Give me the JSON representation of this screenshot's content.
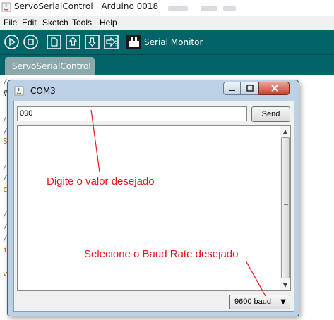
{
  "window": {
    "title": "ServoSerialControl | Arduino 0018"
  },
  "menu": {
    "items": [
      "File",
      "Edit",
      "Sketch",
      "Tools",
      "Help"
    ]
  },
  "toolbar": {
    "buttons": [
      "run-icon",
      "stop-icon",
      "new-icon",
      "open-icon",
      "save-icon",
      "upload-icon"
    ],
    "serial_monitor_label": "Serial Monitor"
  },
  "tabs": [
    {
      "label": "ServoSerialControl"
    }
  ],
  "editor": {
    "visible_code_fragments": [
      "#",
      "//",
      "//",
      "S",
      "//",
      "//",
      "c",
      "//",
      "//",
      "i",
      "v"
    ]
  },
  "dialog": {
    "title": "COM3",
    "input_value": "090",
    "send_label": "Send",
    "baud_value": "9600 baud"
  },
  "annotations": {
    "input_note": "Digite o valor desejado",
    "baud_note": "Selecione o Baud Rate desejado"
  },
  "colors": {
    "toolbar": "#006468",
    "tab": "#8ba9aa",
    "annotation": "#e8161b"
  }
}
